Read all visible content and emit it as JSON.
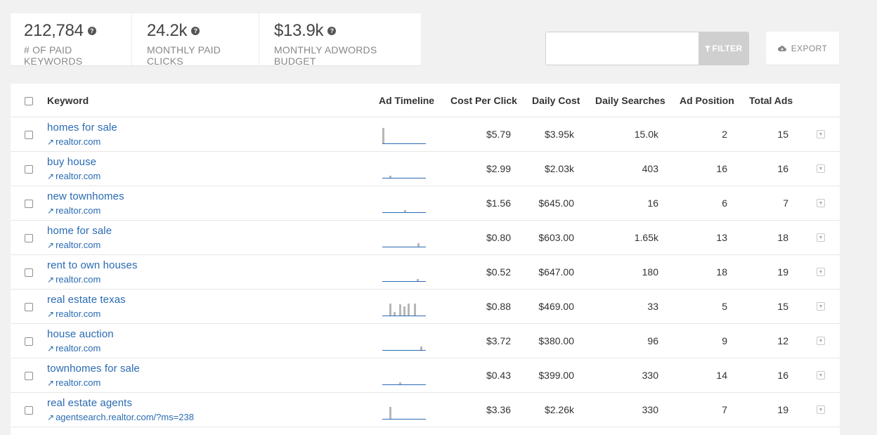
{
  "stats": [
    {
      "value": "212,784",
      "label": "# OF PAID KEYWORDS"
    },
    {
      "value": "24.2k",
      "label": "MONTHLY PAID CLICKS"
    },
    {
      "value": "$13.9k",
      "label": "MONTHLY ADWORDS BUDGET"
    }
  ],
  "filter": {
    "placeholder": "",
    "value": "",
    "button_label": "FILTER"
  },
  "export": {
    "label": "EXPORT"
  },
  "columns": {
    "keyword": "Keyword",
    "timeline": "Ad Timeline",
    "cpc": "Cost Per Click",
    "daily_cost": "Daily Cost",
    "daily_searches": "Daily Searches",
    "ad_position": "Ad Position",
    "total_ads": "Total Ads"
  },
  "rows": [
    {
      "keyword": "homes for sale",
      "domain": "realtor.com",
      "cpc": "$5.79",
      "daily_cost": "$3.95k",
      "daily_searches": "15.0k",
      "ad_position": "2",
      "total_ads": "15"
    },
    {
      "keyword": "buy house",
      "domain": "realtor.com",
      "cpc": "$2.99",
      "daily_cost": "$2.03k",
      "daily_searches": "403",
      "ad_position": "16",
      "total_ads": "16"
    },
    {
      "keyword": "new townhomes",
      "domain": "realtor.com",
      "cpc": "$1.56",
      "daily_cost": "$645.00",
      "daily_searches": "16",
      "ad_position": "6",
      "total_ads": "7"
    },
    {
      "keyword": "home for sale",
      "domain": "realtor.com",
      "cpc": "$0.80",
      "daily_cost": "$603.00",
      "daily_searches": "1.65k",
      "ad_position": "13",
      "total_ads": "18"
    },
    {
      "keyword": "rent to own houses",
      "domain": "realtor.com",
      "cpc": "$0.52",
      "daily_cost": "$647.00",
      "daily_searches": "180",
      "ad_position": "18",
      "total_ads": "19"
    },
    {
      "keyword": "real estate texas",
      "domain": "realtor.com",
      "cpc": "$0.88",
      "daily_cost": "$469.00",
      "daily_searches": "33",
      "ad_position": "5",
      "total_ads": "15"
    },
    {
      "keyword": "house auction",
      "domain": "realtor.com",
      "cpc": "$3.72",
      "daily_cost": "$380.00",
      "daily_searches": "96",
      "ad_position": "9",
      "total_ads": "12"
    },
    {
      "keyword": "townhomes for sale",
      "domain": "realtor.com",
      "cpc": "$0.43",
      "daily_cost": "$399.00",
      "daily_searches": "330",
      "ad_position": "14",
      "total_ads": "16"
    },
    {
      "keyword": "real estate agents",
      "domain": "agentsearch.realtor.com/?ms=238",
      "cpc": "$3.36",
      "daily_cost": "$2.26k",
      "daily_searches": "330",
      "ad_position": "7",
      "total_ads": "19"
    }
  ],
  "colors": {
    "link": "#2a6bb3",
    "spark_bar": "#b7b7b7",
    "filter_button": "#cfcfcf"
  },
  "icons": {
    "help": "question-circle-icon",
    "filter": "funnel-icon",
    "export": "cloud-icon",
    "external": "external-link-icon",
    "row_menu": "caret-down-icon"
  }
}
